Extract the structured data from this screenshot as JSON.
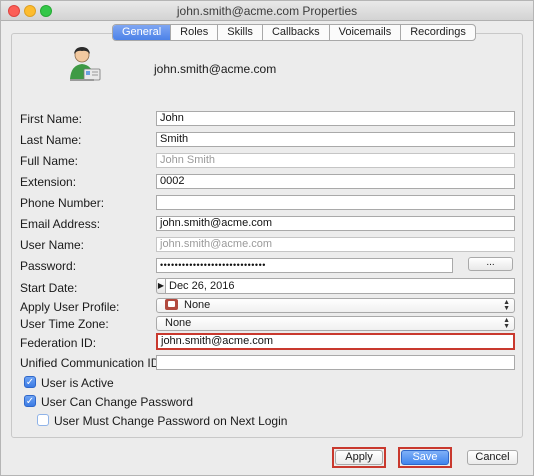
{
  "window": {
    "title": "john.smith@acme.com Properties"
  },
  "tabs": [
    {
      "label": "General",
      "active": true
    },
    {
      "label": "Roles",
      "active": false
    },
    {
      "label": "Skills",
      "active": false
    },
    {
      "label": "Callbacks",
      "active": false
    },
    {
      "label": "Voicemails",
      "active": false
    },
    {
      "label": "Recordings",
      "active": false
    }
  ],
  "header": {
    "email": "john.smith@acme.com",
    "avatar_icon": "user-avatar-icon"
  },
  "form": {
    "first_name": {
      "label": "First Name:",
      "value": "John"
    },
    "last_name": {
      "label": "Last Name:",
      "value": "Smith"
    },
    "full_name": {
      "label": "Full Name:",
      "value": "John Smith"
    },
    "extension": {
      "label": "Extension:",
      "value": "0002"
    },
    "phone_number": {
      "label": "Phone Number:",
      "value": ""
    },
    "email_address": {
      "label": "Email Address:",
      "value": "john.smith@acme.com"
    },
    "user_name": {
      "label": "User Name:",
      "value": "john.smith@acme.com"
    },
    "password": {
      "label": "Password:",
      "value": "•••••••••••••••••••••••••••••",
      "button": "..."
    },
    "start_date": {
      "label": "Start Date:",
      "value": "Dec 26, 2016"
    },
    "apply_user_profile": {
      "label": "Apply User Profile:",
      "value": "None"
    },
    "user_time_zone": {
      "label": "User Time Zone:",
      "value": "None"
    },
    "federation_id": {
      "label": "Federation ID:",
      "value": "john.smith@acme.com"
    },
    "unified_communication_id": {
      "label": "Unified Communication ID:",
      "value": ""
    }
  },
  "checkboxes": {
    "user_is_active": {
      "label": "User is Active",
      "checked": true
    },
    "user_can_change_password": {
      "label": "User Can Change Password",
      "checked": true
    },
    "user_must_change_password": {
      "label": "User Must Change Password on Next Login",
      "checked": false
    }
  },
  "buttons": {
    "apply": "Apply",
    "save": "Save",
    "cancel": "Cancel"
  },
  "colors": {
    "accent": "#4c82e8",
    "highlight": "#c9392e"
  }
}
